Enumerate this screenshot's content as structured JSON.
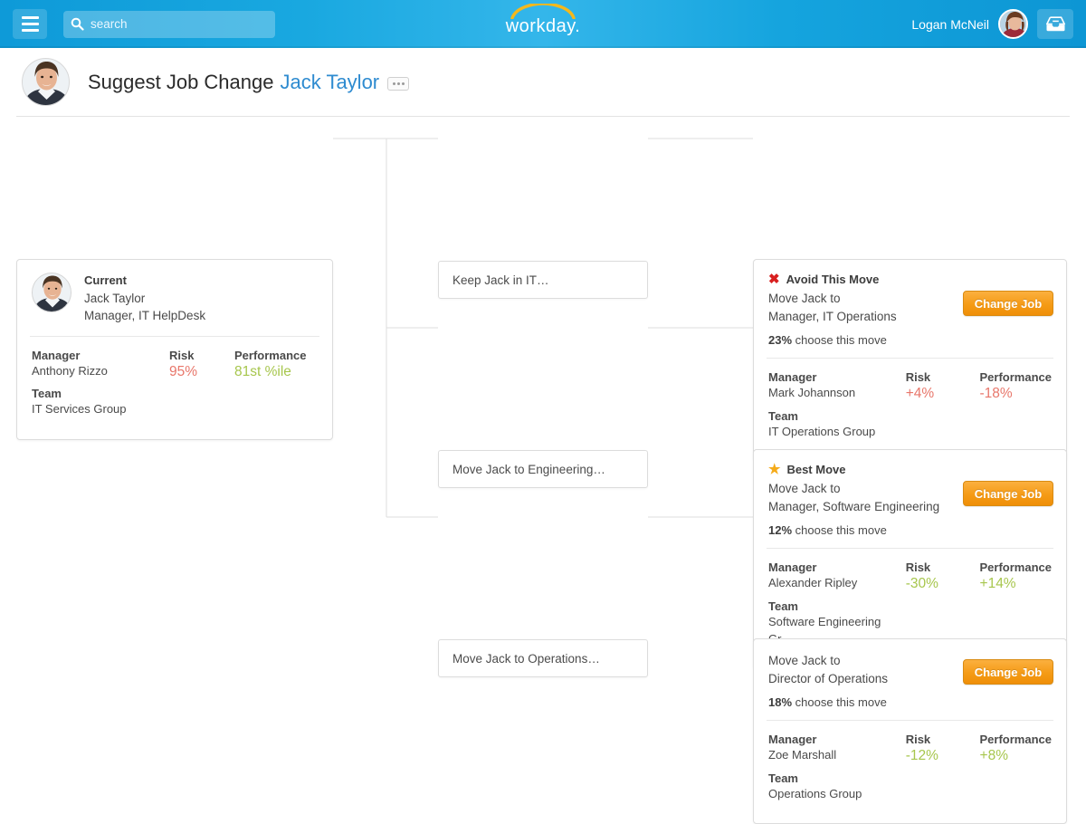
{
  "topbar": {
    "menu_icon": "hamburger-icon",
    "search": {
      "icon": "search-icon",
      "value": "",
      "placeholder": "search"
    },
    "brand": {
      "name": "workday",
      "dot": "."
    },
    "user": {
      "name": "Logan McNeil",
      "avatar": "user-avatar"
    },
    "inbox_icon": "inbox-icon",
    "accent_blue": "#19a8e0"
  },
  "page": {
    "title": "Suggest Job Change",
    "subject": "Jack Taylor",
    "overflow_menu": "ellipsis-menu",
    "avatar": "employee-photo"
  },
  "current": {
    "label": "Current",
    "name": "Jack Taylor",
    "role": "Manager, IT HelpDesk",
    "manager_label": "Manager",
    "manager_value": "Anthony Rizzo",
    "team_label": "Team",
    "team_value": "IT Services Group",
    "risk_label": "Risk",
    "risk_value": "95%",
    "perf_label": "Performance",
    "perf_value": "81st %ile"
  },
  "branches": [
    {
      "label": "Keep Jack in IT…"
    },
    {
      "label": "Move Jack to Engineering…"
    },
    {
      "label": "Move Jack to Operations…"
    }
  ],
  "options": [
    {
      "badge": "Avoid This Move",
      "badge_mark": "x-mark-icon",
      "move_line1": "Move Jack to",
      "move_line2": "Manager, IT Operations",
      "share_pct": "23%",
      "share_text": " choose this move",
      "button": "Change Job",
      "manager_label": "Manager",
      "manager_value": "Mark Johannson",
      "team_label": "Team",
      "team_value": "IT Operations Group",
      "risk_label": "Risk",
      "risk_value": "+4%",
      "risk_tone": "negative",
      "perf_label": "Performance",
      "perf_value": "-18%",
      "perf_tone": "negative"
    },
    {
      "badge": "Best Move",
      "badge_mark": "star-icon",
      "move_line1": "Move Jack to",
      "move_line2": "Manager, Software Engineering",
      "share_pct": "12%",
      "share_text": " choose this move",
      "button": "Change Job",
      "manager_label": "Manager",
      "manager_value": "Alexander Ripley",
      "team_label": "Team",
      "team_value": "Software Engineering Gr…",
      "risk_label": "Risk",
      "risk_value": "-30%",
      "risk_tone": "positive",
      "perf_label": "Performance",
      "perf_value": "+14%",
      "perf_tone": "positive"
    },
    {
      "badge": "",
      "badge_mark": "",
      "move_line1": "Move Jack to",
      "move_line2": "Director of Operations",
      "share_pct": "18%",
      "share_text": " choose this move",
      "button": "Change Job",
      "manager_label": "Manager",
      "manager_value": "Zoe Marshall",
      "team_label": "Team",
      "team_value": "Operations Group",
      "risk_label": "Risk",
      "risk_value": "-12%",
      "risk_tone": "positive",
      "perf_label": "Performance",
      "perf_value": "+8%",
      "perf_tone": "positive"
    }
  ],
  "colors": {
    "negative": "#e8776b",
    "positive": "#a7c64d",
    "button_orange": "#f59b16",
    "link_blue": "#2e8bd0",
    "star_gold": "#f5ab1a",
    "x_red": "#d81f1f"
  }
}
